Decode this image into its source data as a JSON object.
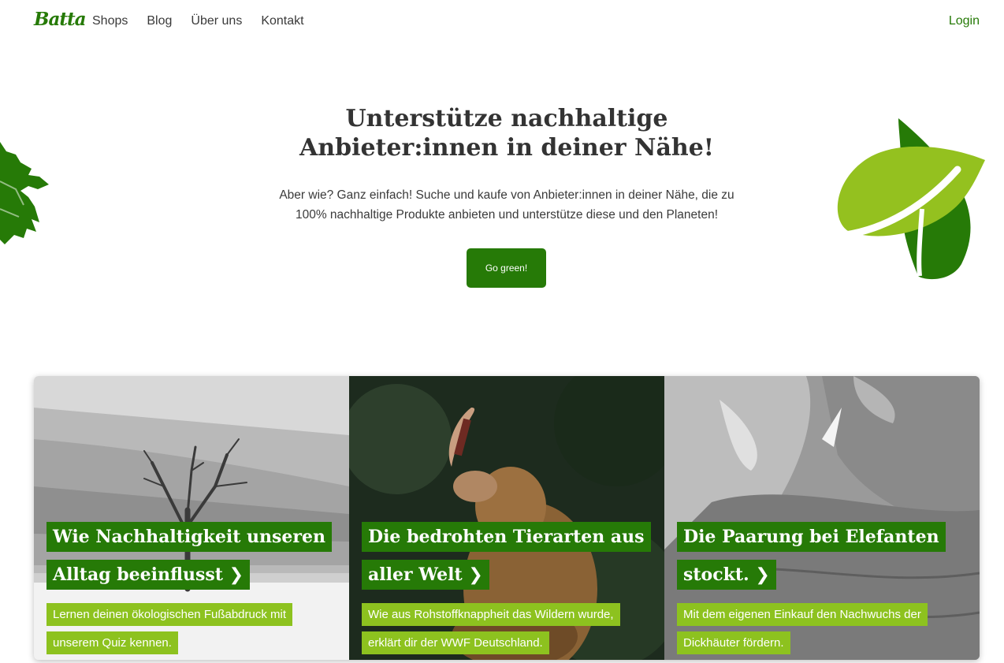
{
  "nav": {
    "logo": "Batta",
    "links": [
      "Shops",
      "Blog",
      "Über uns",
      "Kontakt"
    ],
    "login": "Login"
  },
  "hero": {
    "title_line1": "Unterstütze nachhaltige",
    "title_line2": "Anbieter:innen in deiner Nähe!",
    "text_line1": "Aber wie? Ganz einfach! Suche und kaufe von Anbieter:innen in deiner Nähe, die zu",
    "text_line2": "100% nachhaltige Produkte anbieten und unterstütze diese und den Planeten!",
    "button": "Go green!"
  },
  "cards": [
    {
      "headline": "Wie Nachhaltigkeit unseren Alltag beeinflusst",
      "subtext": "Lernen deinen ökologischen Fußabdruck mit unserem Quiz kennen."
    },
    {
      "headline": "Die bedrohten Tierarten aus aller Welt",
      "subtext": "Wie aus Rohstoffknappheit das Wildern wurde, erklärt dir der WWF Deutschland."
    },
    {
      "headline": "Die Paarung bei Elefanten stockt.",
      "subtext": "Mit dem eigenen Einkauf den Nachwuchs der Dickhäuter fördern."
    }
  ],
  "icons": {
    "arrow": "❯",
    "leaf_left": "leaf-left-icon",
    "leaf_right": "leaves-right-icon"
  },
  "colors": {
    "brand_green": "#267a07",
    "accent_green": "#8dc21f"
  }
}
